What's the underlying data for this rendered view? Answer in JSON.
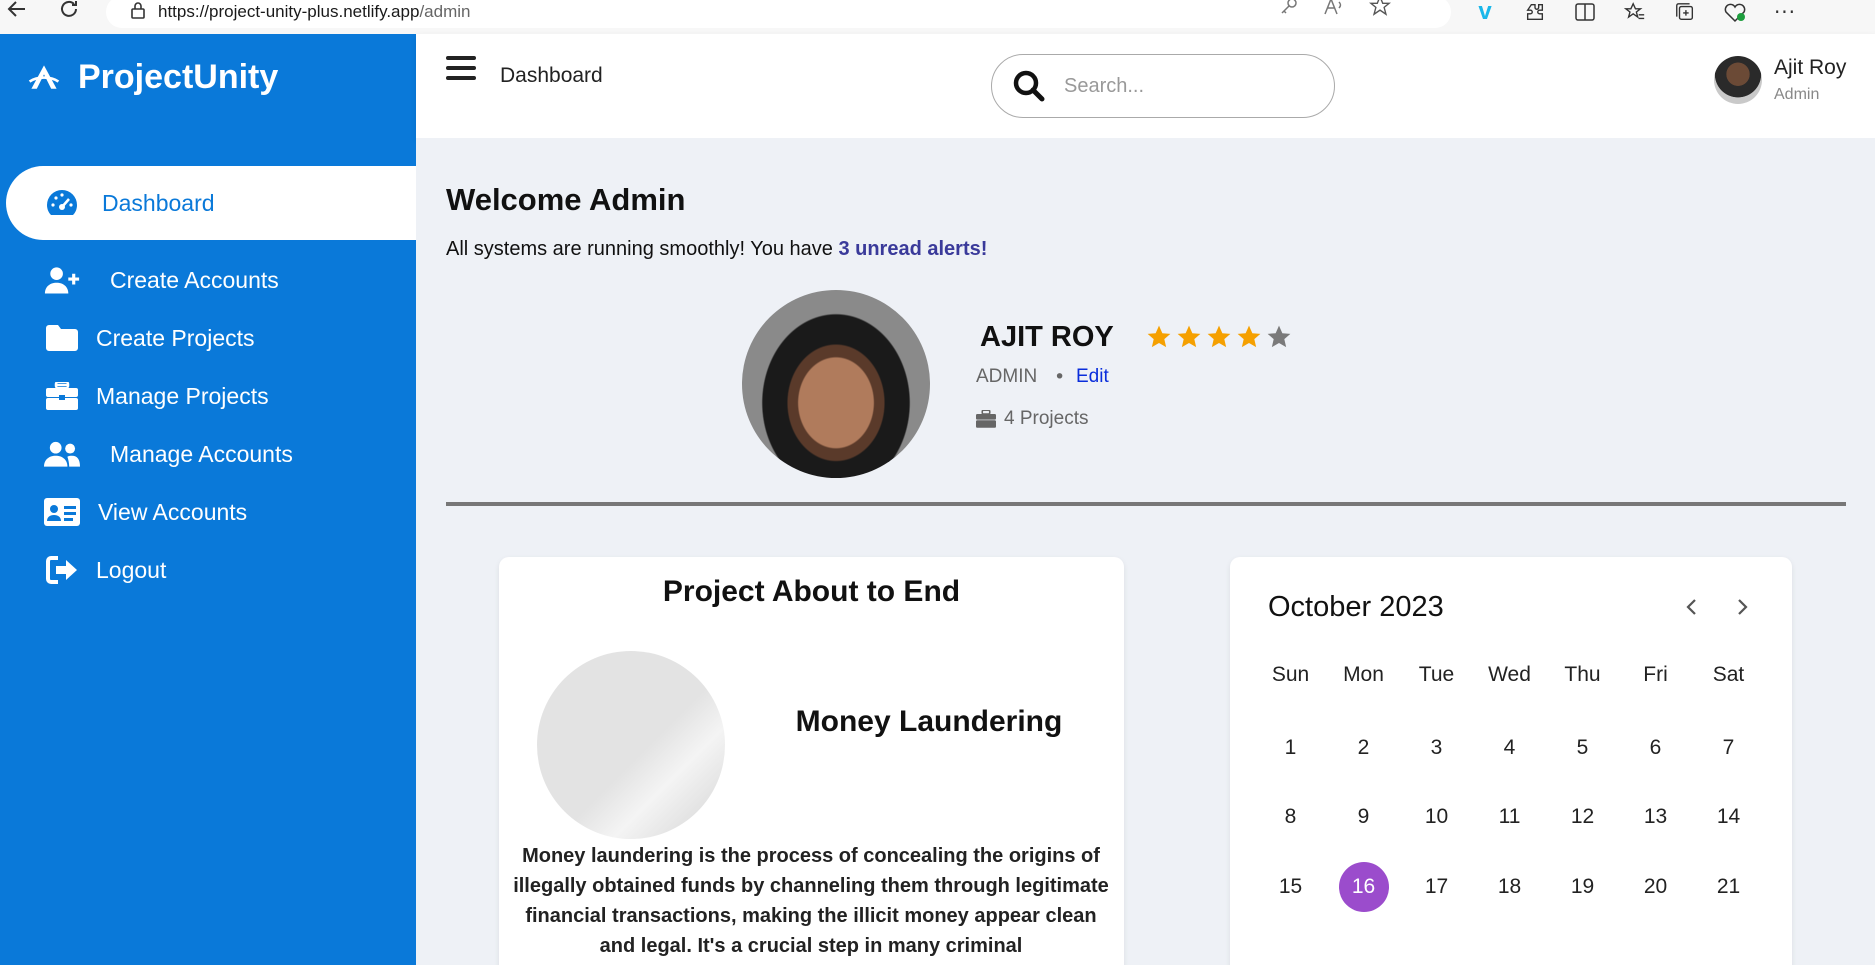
{
  "browser": {
    "url_host": "https://project-unity-plus.netlify.app",
    "url_path": "/admin"
  },
  "brand": {
    "name": "ProjectUnity"
  },
  "sidebar": {
    "items": [
      {
        "label": "Dashboard",
        "icon": "tachometer-icon",
        "active": true
      },
      {
        "label": "Create Accounts",
        "icon": "user-plus-icon"
      },
      {
        "label": "Create Projects",
        "icon": "folder-icon"
      },
      {
        "label": "Manage Projects",
        "icon": "briefcase-icon"
      },
      {
        "label": "Manage Accounts",
        "icon": "users-icon"
      },
      {
        "label": "View Accounts",
        "icon": "id-card-icon"
      },
      {
        "label": "Logout",
        "icon": "sign-out-icon"
      }
    ]
  },
  "header": {
    "title": "Dashboard",
    "search_placeholder": "Search...",
    "user_name": "Ajit Roy",
    "user_role": "Admin"
  },
  "main": {
    "welcome": "Welcome Admin",
    "subtitle_prefix": "All systems are running smoothly! You have ",
    "alerts_text": "3 unread alerts!",
    "profile": {
      "name": "AJIT ROY",
      "rating": 4,
      "rating_max": 5,
      "role": "ADMIN",
      "separator": "•",
      "edit_label": "Edit",
      "projects": "4 Projects"
    },
    "project_card": {
      "title": "Project About to End",
      "project_name": "Money Laundering",
      "description": "Money laundering is the process of concealing the origins of illegally obtained funds by channeling them through legitimate financial transactions, making the illicit money appear clean and legal. It's a crucial step in many criminal"
    },
    "calendar": {
      "month_label": "October 2023",
      "weekdays": [
        "Sun",
        "Mon",
        "Tue",
        "Wed",
        "Thu",
        "Fri",
        "Sat"
      ],
      "days": [
        "1",
        "2",
        "3",
        "4",
        "5",
        "6",
        "7",
        "8",
        "9",
        "10",
        "11",
        "12",
        "13",
        "14",
        "15",
        "16",
        "17",
        "18",
        "19",
        "20",
        "21"
      ],
      "today": "16"
    }
  },
  "colors": {
    "sidebar": "#0a79d9",
    "star": "#f5a000",
    "star_empty": "#7a7a7a",
    "today": "#9b4ccc",
    "alert": "#3a3a9a",
    "edit": "#0a2ddb"
  }
}
